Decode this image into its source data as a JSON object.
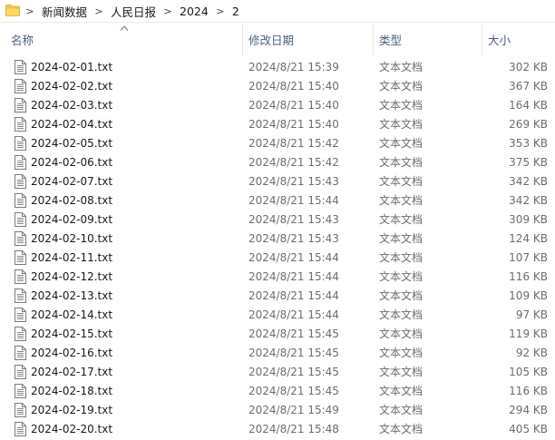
{
  "breadcrumb": {
    "items": [
      "新闻数据",
      "人民日报",
      "2024",
      "2"
    ],
    "separator": ">"
  },
  "icons": {
    "folder": "folder-icon",
    "file": "text-file-icon",
    "sort": "sort-ascending-icon"
  },
  "header": {
    "name": "名称",
    "date": "修改日期",
    "type": "类型",
    "size": "大小"
  },
  "files": [
    {
      "name": "2024-02-01.txt",
      "date": "2024/8/21 15:39",
      "type": "文本文档",
      "size": "302 KB"
    },
    {
      "name": "2024-02-02.txt",
      "date": "2024/8/21 15:40",
      "type": "文本文档",
      "size": "367 KB"
    },
    {
      "name": "2024-02-03.txt",
      "date": "2024/8/21 15:40",
      "type": "文本文档",
      "size": "164 KB"
    },
    {
      "name": "2024-02-04.txt",
      "date": "2024/8/21 15:40",
      "type": "文本文档",
      "size": "269 KB"
    },
    {
      "name": "2024-02-05.txt",
      "date": "2024/8/21 15:42",
      "type": "文本文档",
      "size": "353 KB"
    },
    {
      "name": "2024-02-06.txt",
      "date": "2024/8/21 15:42",
      "type": "文本文档",
      "size": "375 KB"
    },
    {
      "name": "2024-02-07.txt",
      "date": "2024/8/21 15:43",
      "type": "文本文档",
      "size": "342 KB"
    },
    {
      "name": "2024-02-08.txt",
      "date": "2024/8/21 15:44",
      "type": "文本文档",
      "size": "342 KB"
    },
    {
      "name": "2024-02-09.txt",
      "date": "2024/8/21 15:43",
      "type": "文本文档",
      "size": "309 KB"
    },
    {
      "name": "2024-02-10.txt",
      "date": "2024/8/21 15:43",
      "type": "文本文档",
      "size": "124 KB"
    },
    {
      "name": "2024-02-11.txt",
      "date": "2024/8/21 15:44",
      "type": "文本文档",
      "size": "107 KB"
    },
    {
      "name": "2024-02-12.txt",
      "date": "2024/8/21 15:44",
      "type": "文本文档",
      "size": "116 KB"
    },
    {
      "name": "2024-02-13.txt",
      "date": "2024/8/21 15:44",
      "type": "文本文档",
      "size": "109 KB"
    },
    {
      "name": "2024-02-14.txt",
      "date": "2024/8/21 15:44",
      "type": "文本文档",
      "size": "97 KB"
    },
    {
      "name": "2024-02-15.txt",
      "date": "2024/8/21 15:45",
      "type": "文本文档",
      "size": "119 KB"
    },
    {
      "name": "2024-02-16.txt",
      "date": "2024/8/21 15:45",
      "type": "文本文档",
      "size": "92 KB"
    },
    {
      "name": "2024-02-17.txt",
      "date": "2024/8/21 15:45",
      "type": "文本文档",
      "size": "105 KB"
    },
    {
      "name": "2024-02-18.txt",
      "date": "2024/8/21 15:45",
      "type": "文本文档",
      "size": "116 KB"
    },
    {
      "name": "2024-02-19.txt",
      "date": "2024/8/21 15:49",
      "type": "文本文档",
      "size": "294 KB"
    },
    {
      "name": "2024-02-20.txt",
      "date": "2024/8/21 15:48",
      "type": "文本文档",
      "size": "405 KB"
    }
  ]
}
